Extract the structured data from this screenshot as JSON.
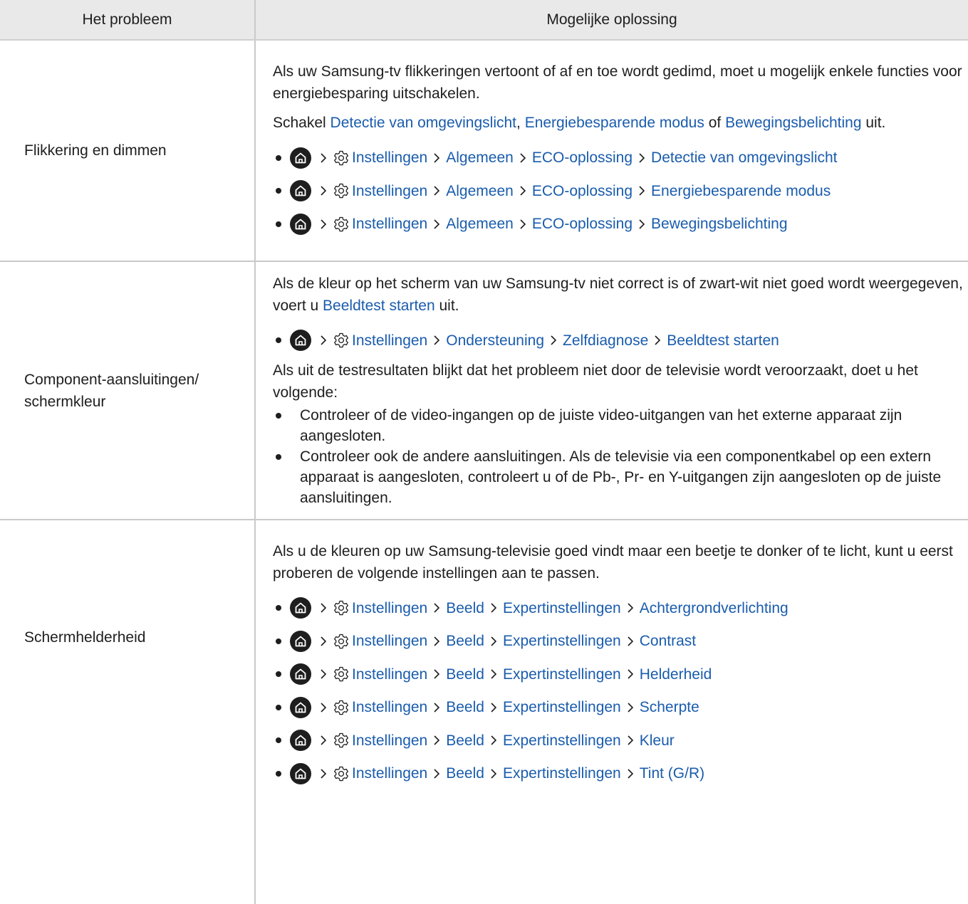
{
  "header": {
    "col_problem": "Het probleem",
    "col_solution": "Mogelijke oplossing"
  },
  "rows": [
    {
      "problem": "Flikkering en dimmen",
      "intro": "Als uw Samsung-tv flikkeringen vertoont of af en toe wordt gedimd, moet u mogelijk enkele functies voor energiebesparing uitschakelen.",
      "text_pre": "Schakel ",
      "link1": "Detectie van omgevingslicht",
      "sep1": ", ",
      "link2": "Energiebesparende modus",
      "sep2": " of ",
      "link3": "Bewegingsbelichting",
      "text_post": " uit.",
      "paths": [
        [
          "Instellingen",
          "Algemeen",
          "ECO-oplossing",
          "Detectie van omgevingslicht"
        ],
        [
          "Instellingen",
          "Algemeen",
          "ECO-oplossing",
          "Energiebesparende modus"
        ],
        [
          "Instellingen",
          "Algemeen",
          "ECO-oplossing",
          "Bewegingsbelichting"
        ]
      ]
    },
    {
      "problem_line1": "Component-aansluitingen/",
      "problem_line2": "schermkleur",
      "intro_pre": "Als de kleur op het scherm van uw Samsung-tv niet correct is of zwart-wit niet goed wordt weergegeven, voert u ",
      "intro_link": "Beeldtest starten",
      "intro_post": " uit.",
      "paths": [
        [
          "Instellingen",
          "Ondersteuning",
          "Zelfdiagnose",
          "Beeldtest starten"
        ]
      ],
      "after": "Als uit de testresultaten blijkt dat het probleem niet door de televisie wordt veroorzaakt, doet u het volgende:",
      "bullets": [
        "Controleer of de video-ingangen op de juiste video-uitgangen van het externe apparaat zijn aangesloten.",
        "Controleer ook de andere aansluitingen. Als de televisie via een componentkabel op een extern apparaat is aangesloten, controleert u of de Pb-, Pr- en Y-uitgangen zijn aangesloten op de juiste aansluitingen."
      ]
    },
    {
      "problem": "Schermhelderheid",
      "intro": "Als u de kleuren op uw Samsung-televisie goed vindt maar een beetje te donker of te licht, kunt u eerst proberen de volgende instellingen aan te passen.",
      "paths": [
        [
          "Instellingen",
          "Beeld",
          "Expertinstellingen",
          "Achtergrondverlichting"
        ],
        [
          "Instellingen",
          "Beeld",
          "Expertinstellingen",
          "Contrast"
        ],
        [
          "Instellingen",
          "Beeld",
          "Expertinstellingen",
          "Helderheid"
        ],
        [
          "Instellingen",
          "Beeld",
          "Expertinstellingen",
          "Scherpte"
        ],
        [
          "Instellingen",
          "Beeld",
          "Expertinstellingen",
          "Kleur"
        ],
        [
          "Instellingen",
          "Beeld",
          "Expertinstellingen",
          "Tint (G/R)"
        ]
      ]
    }
  ],
  "colors": {
    "link": "#1a5cad",
    "header_bg": "#e9e9e9",
    "text": "#1e1e1e"
  },
  "icons": {
    "home": "home-icon",
    "settings": "gear-icon",
    "separator": "chevron-right-icon"
  }
}
